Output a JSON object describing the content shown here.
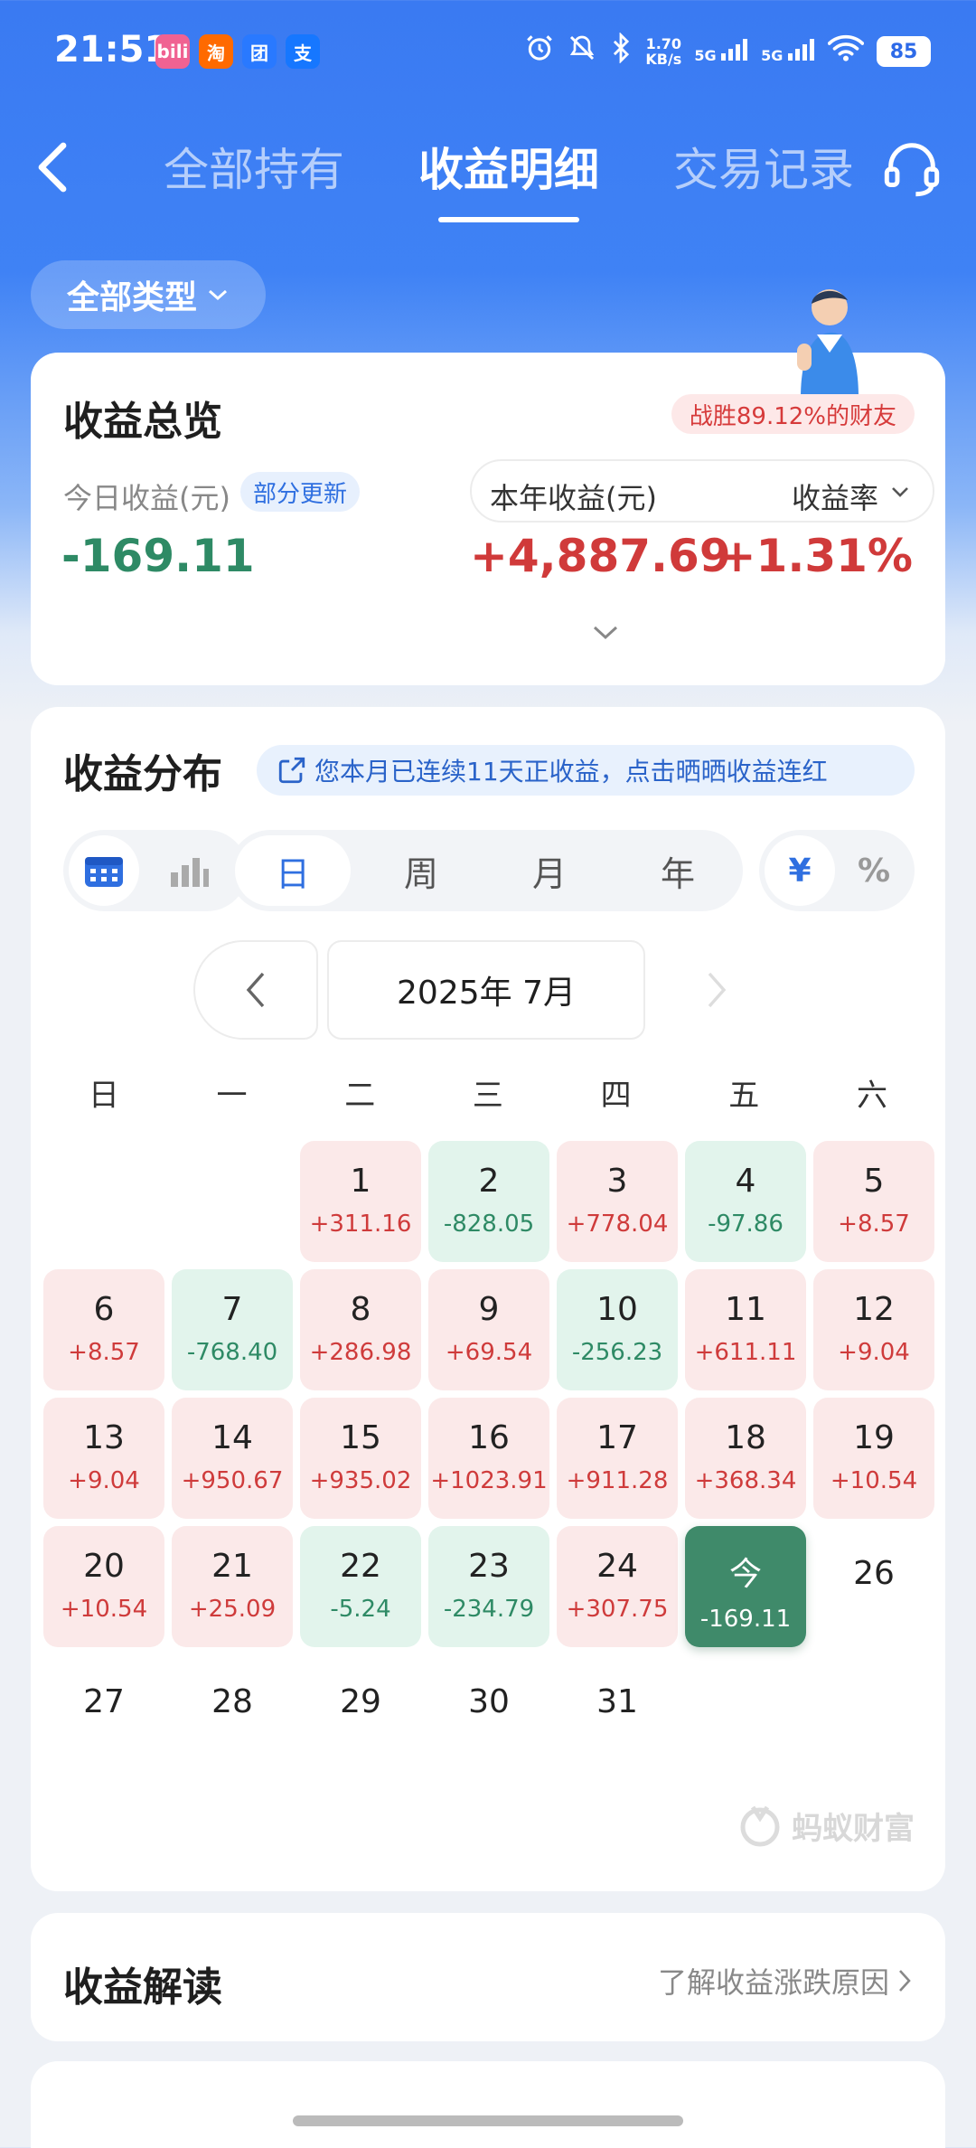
{
  "status_bar": {
    "time": "21:51",
    "apps": [
      {
        "icon": "bilibili-icon",
        "text": "bili",
        "color": "#f06292"
      },
      {
        "icon": "taobao-icon",
        "text": "淘",
        "color": "#ff6a00"
      },
      {
        "icon": "meituan-icon",
        "text": "团",
        "color": "#2979ff"
      },
      {
        "icon": "alipay-icon",
        "text": "支",
        "color": "#1677ff"
      }
    ],
    "net_speed_value": "1.70",
    "net_speed_unit": "KB/s",
    "sim1": "5G",
    "sim2": "5G",
    "battery": "85"
  },
  "header": {
    "tabs": [
      {
        "label": "全部持有",
        "active": false
      },
      {
        "label": "收益明细",
        "active": true
      },
      {
        "label": "交易记录",
        "active": false
      }
    ]
  },
  "filter": {
    "label": "全部类型"
  },
  "overview": {
    "title": "收益总览",
    "beat_badge": "战胜89.12%的财友",
    "today_label": "今日收益(元)",
    "partial_badge": "部分更新",
    "today_value": "-169.11",
    "year_label": "本年收益(元)",
    "rate_label": "收益率",
    "year_value": "+4,887.69",
    "rate_value": "+1.31%"
  },
  "distribution": {
    "title": "收益分布",
    "streak_text": "您本月已连续11天正收益，点击晒晒收益连红",
    "period_options": [
      "日",
      "周",
      "月",
      "年"
    ],
    "period_selected": "日",
    "unit_options": [
      "¥",
      "%"
    ],
    "unit_selected": "¥",
    "month_label": "2025年 7月",
    "weekdays": [
      "日",
      "一",
      "二",
      "三",
      "四",
      "五",
      "六"
    ],
    "first_weekday_index": 2,
    "days": [
      {
        "num": "1",
        "val": "+311.16",
        "type": "pos"
      },
      {
        "num": "2",
        "val": "-828.05",
        "type": "neg"
      },
      {
        "num": "3",
        "val": "+778.04",
        "type": "pos"
      },
      {
        "num": "4",
        "val": "-97.86",
        "type": "neg"
      },
      {
        "num": "5",
        "val": "+8.57",
        "type": "pos"
      },
      {
        "num": "6",
        "val": "+8.57",
        "type": "pos"
      },
      {
        "num": "7",
        "val": "-768.40",
        "type": "neg"
      },
      {
        "num": "8",
        "val": "+286.98",
        "type": "pos"
      },
      {
        "num": "9",
        "val": "+69.54",
        "type": "pos"
      },
      {
        "num": "10",
        "val": "-256.23",
        "type": "neg"
      },
      {
        "num": "11",
        "val": "+611.11",
        "type": "pos"
      },
      {
        "num": "12",
        "val": "+9.04",
        "type": "pos"
      },
      {
        "num": "13",
        "val": "+9.04",
        "type": "pos"
      },
      {
        "num": "14",
        "val": "+950.67",
        "type": "pos"
      },
      {
        "num": "15",
        "val": "+935.02",
        "type": "pos"
      },
      {
        "num": "16",
        "val": "+1023.91",
        "type": "pos"
      },
      {
        "num": "17",
        "val": "+911.28",
        "type": "pos"
      },
      {
        "num": "18",
        "val": "+368.34",
        "type": "pos"
      },
      {
        "num": "19",
        "val": "+10.54",
        "type": "pos"
      },
      {
        "num": "20",
        "val": "+10.54",
        "type": "pos"
      },
      {
        "num": "21",
        "val": "+25.09",
        "type": "pos"
      },
      {
        "num": "22",
        "val": "-5.24",
        "type": "neg"
      },
      {
        "num": "23",
        "val": "-234.79",
        "type": "neg"
      },
      {
        "num": "24",
        "val": "+307.75",
        "type": "pos"
      },
      {
        "num": "今",
        "val": "-169.11",
        "type": "today"
      },
      {
        "num": "26",
        "val": "",
        "type": "plain"
      },
      {
        "num": "27",
        "val": "",
        "type": "plain"
      },
      {
        "num": "28",
        "val": "",
        "type": "plain"
      },
      {
        "num": "29",
        "val": "",
        "type": "plain"
      },
      {
        "num": "30",
        "val": "",
        "type": "plain"
      },
      {
        "num": "31",
        "val": "",
        "type": "plain"
      }
    ],
    "watermark": "蚂蚁财富"
  },
  "analysis": {
    "title": "收益解读",
    "link": "了解收益涨跌原因"
  },
  "colors": {
    "brand_blue": "#3a7af2",
    "positive_red": "#cf3b3b",
    "negative_green": "#2e8a65",
    "today_green": "#3f8a6a"
  }
}
